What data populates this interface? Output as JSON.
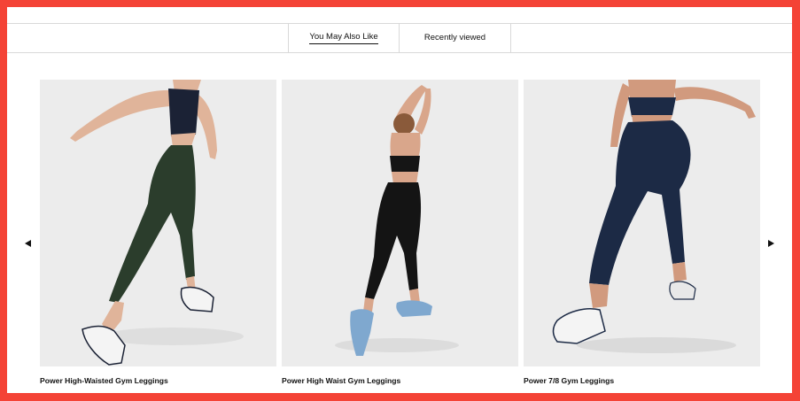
{
  "tabs": [
    {
      "label": "You May Also Like",
      "active": true
    },
    {
      "label": "Recently viewed",
      "active": false
    }
  ],
  "carousel": {
    "prev_icon": "triangle-left-icon",
    "next_icon": "triangle-right-icon"
  },
  "products": [
    {
      "name": "Power High-Waisted Gym Leggings",
      "legging_color": "#2b3d2c"
    },
    {
      "name": "Power High Waist Gym Leggings",
      "legging_color": "#141414"
    },
    {
      "name": "Power 7/8 Gym Leggings",
      "legging_color": "#1c2a45"
    }
  ],
  "colors": {
    "frame": "#f44336",
    "image_bg": "#ececec"
  }
}
